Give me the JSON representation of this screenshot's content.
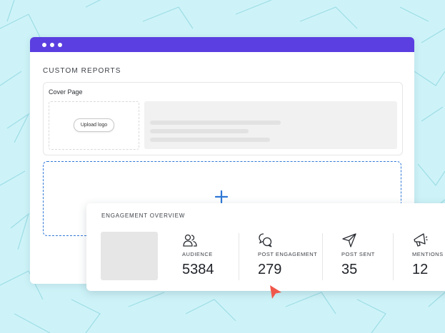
{
  "colors": {
    "background": "#cdf3f8",
    "pattern_lines": "#9edde6",
    "titlebar": "#5b3fe0",
    "dropzone_accent": "#2f78d6",
    "cursor": "#f0574b"
  },
  "window": {
    "page_title": "CUSTOM REPORTS",
    "cover": {
      "title": "Cover Page",
      "upload_label": "Upload logo"
    },
    "dropzone": {
      "icon": "plus-icon"
    }
  },
  "engagement": {
    "title": "ENGAGEMENT OVERVIEW",
    "metrics": [
      {
        "icon": "people-icon",
        "label": "AUDIENCE",
        "value": "5384"
      },
      {
        "icon": "chat-bubbles-icon",
        "label": "POST ENGAGEMENT",
        "value": "279"
      },
      {
        "icon": "send-icon",
        "label": "POST SENT",
        "value": "35"
      },
      {
        "icon": "megaphone-icon",
        "label": "MENTIONS",
        "value": "12"
      }
    ]
  }
}
